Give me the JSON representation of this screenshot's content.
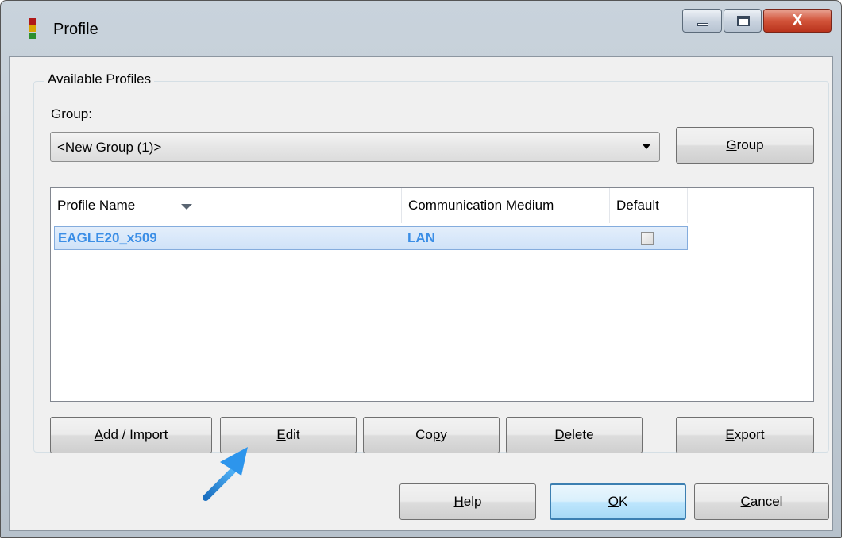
{
  "window": {
    "title": "Profile",
    "close_glyph": "X"
  },
  "available_profiles": {
    "legend": "Available Profiles",
    "group_label": "Group:",
    "group_value": "<New Group (1)>",
    "group_button": {
      "mnemonic": "G",
      "rest": "roup"
    }
  },
  "table": {
    "columns": [
      "Profile Name",
      "Communication Medium",
      "Default"
    ],
    "sort_column": "Profile Name",
    "rows": [
      {
        "profile_name": "EAGLE20_x509",
        "medium": "LAN",
        "default": false,
        "selected": true
      }
    ]
  },
  "action_buttons": [
    {
      "mnemonic": "A",
      "rest": "dd / Import"
    },
    {
      "mnemonic": "E",
      "rest": "dit"
    },
    {
      "pre": "Co",
      "mnemonic": "p",
      "rest": "y"
    },
    {
      "mnemonic": "D",
      "rest": "elete"
    },
    {
      "mnemonic": "E",
      "rest": "xport"
    }
  ],
  "dialog_buttons": [
    {
      "mnemonic": "H",
      "rest": "elp"
    },
    {
      "mnemonic": "O",
      "rest": "K",
      "default": true
    },
    {
      "mnemonic": "C",
      "rest": "ancel"
    }
  ],
  "annotation": {
    "points_to": "edit-button",
    "color": "#1f8be6"
  },
  "icons": [
    "traffic-light-app-icon",
    "minimize-icon",
    "maximize-icon",
    "close-icon",
    "dropdown-arrow-icon",
    "sort-arrow-icon",
    "annotation-arrow-icon"
  ]
}
